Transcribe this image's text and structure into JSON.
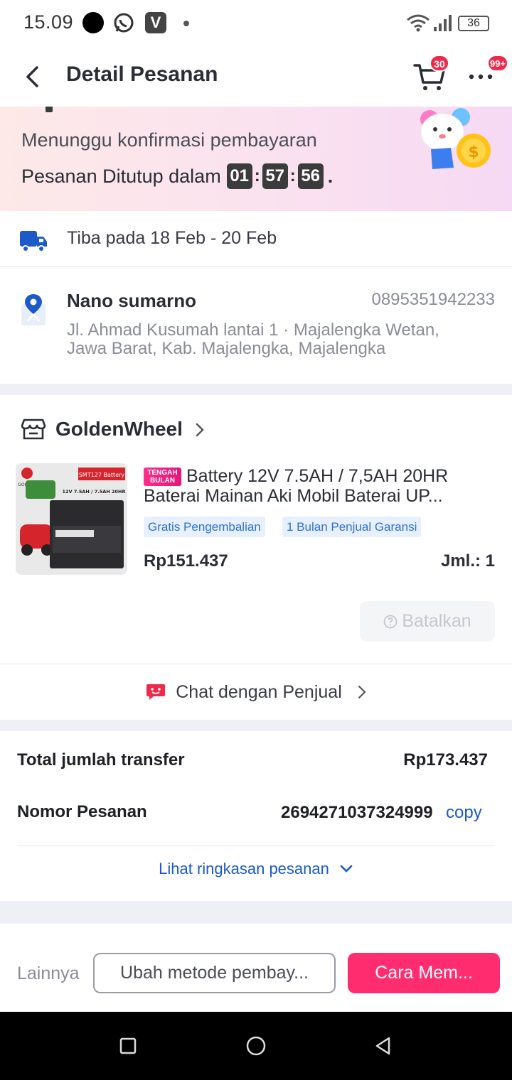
{
  "status_bar": {
    "time": "15.09",
    "battery": "36"
  },
  "header": {
    "title": "Detail Pesanan",
    "cart_badge": "30",
    "more_badge": "99+"
  },
  "banner": {
    "status": "Menunggu konfirmasi pembayaran",
    "countdown_label": "Pesanan Ditutup dalam",
    "hours": "01",
    "minutes": "57",
    "seconds": "56",
    "countdown_suffix": "."
  },
  "delivery": {
    "text": "Tiba pada 18 Feb - 20 Feb"
  },
  "address": {
    "name": "Nano sumarno",
    "phone": "0895351942233",
    "line1": "Jl. Ahmad Kusumah lantai 1 · Majalengka Wetan,",
    "line2": "Jawa Barat, Kab. Majalengka, Majalengka"
  },
  "store": {
    "name": "GoldenWheel"
  },
  "product": {
    "promo_line1": "TENGAH",
    "promo_line2": "BULAN",
    "title": "Battery 12V 7.5AH / 7,5AH 20HR Baterai Mainan Aki Mobil Baterai UP...",
    "chips": [
      "Gratis Pengembalian",
      "1 Bulan Penjual Garansi"
    ],
    "price": "Rp151.437",
    "quantity": "Jml.: 1",
    "image_labels": {
      "brand": "GOLDEN",
      "tag": "SMT127 Battery",
      "spec": "12V 7.5AH / 7.5AH 20HR"
    }
  },
  "cancel_button": "Batalkan",
  "chat": {
    "label": "Chat dengan Penjual"
  },
  "summary": {
    "total_label": "Total jumlah transfer",
    "total_value": "Rp173.437",
    "order_label": "Nomor Pesanan",
    "order_number": "2694271037324999",
    "copy_label": "copy",
    "link_label": "Lihat ringkasan pesanan"
  },
  "actions": {
    "more": "Lainnya",
    "change_payment": "Ubah metode pembay...",
    "how_to_pay": "Cara Mem..."
  },
  "colors": {
    "accent_pink": "#ff2d6f",
    "link_blue": "#1c59c9",
    "badge_red": "#f0284a",
    "chip_blue": "#2f6fd8"
  }
}
